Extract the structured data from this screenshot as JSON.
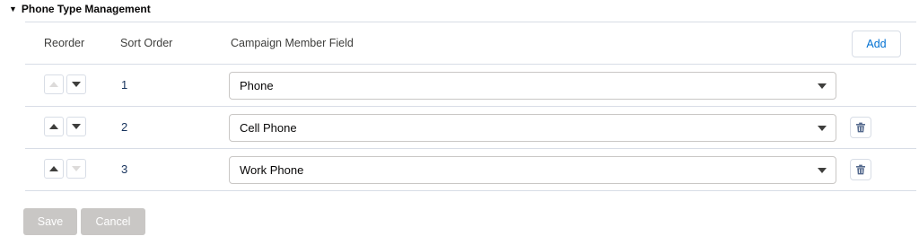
{
  "section": {
    "title": "Phone Type Management",
    "expanded": true
  },
  "table": {
    "headers": {
      "reorder": "Reorder",
      "sort_order": "Sort Order",
      "field": "Campaign Member Field"
    },
    "add_label": "Add",
    "rows": [
      {
        "sort": "1",
        "field": "Phone",
        "up_enabled": false,
        "down_enabled": true,
        "deletable": false
      },
      {
        "sort": "2",
        "field": "Cell Phone",
        "up_enabled": true,
        "down_enabled": true,
        "deletable": true
      },
      {
        "sort": "3",
        "field": "Work Phone",
        "up_enabled": true,
        "down_enabled": false,
        "deletable": true
      }
    ]
  },
  "actions": {
    "save_label": "Save",
    "cancel_label": "Cancel",
    "disabled": true
  },
  "colors": {
    "accent": "#0070d2",
    "border": "#d8dde6",
    "disabled_button": "#c9c7c5",
    "text": "#16325c"
  },
  "icons": {
    "collapse": "caret-down-icon",
    "move_up": "arrow-up-icon",
    "move_down": "arrow-down-icon",
    "delete": "trash-icon",
    "dropdown": "chevron-down-icon"
  }
}
